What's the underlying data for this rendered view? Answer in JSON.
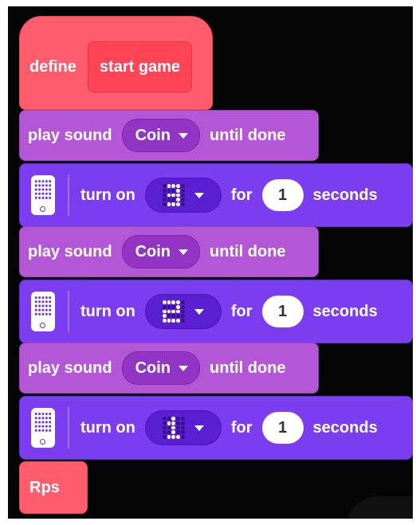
{
  "define_block": {
    "keyword": "define",
    "name": "start game"
  },
  "stack": [
    {
      "type": "sound",
      "prefix": "play sound",
      "sound": "Coin",
      "suffix": "until done"
    },
    {
      "type": "light",
      "prefix": "turn on",
      "pattern": [
        0,
        1,
        1,
        1,
        0,
        0,
        0,
        0,
        1,
        0,
        0,
        1,
        1,
        1,
        0,
        0,
        0,
        0,
        1,
        0,
        0,
        1,
        1,
        1,
        0
      ],
      "mid": "for",
      "value": "1",
      "unit": "seconds"
    },
    {
      "type": "sound",
      "prefix": "play sound",
      "sound": "Coin",
      "suffix": "until done"
    },
    {
      "type": "light",
      "prefix": "turn on",
      "pattern": [
        1,
        1,
        1,
        1,
        0,
        0,
        0,
        0,
        1,
        0,
        1,
        1,
        1,
        1,
        0,
        1,
        0,
        0,
        0,
        0,
        1,
        1,
        1,
        1,
        0
      ],
      "mid": "for",
      "value": "1",
      "unit": "seconds"
    },
    {
      "type": "sound",
      "prefix": "play sound",
      "sound": "Coin",
      "suffix": "until done"
    },
    {
      "type": "light",
      "prefix": "turn on",
      "pattern": [
        0,
        0,
        1,
        0,
        0,
        0,
        1,
        1,
        0,
        0,
        0,
        0,
        1,
        0,
        0,
        0,
        0,
        1,
        0,
        0,
        0,
        1,
        1,
        1,
        0
      ],
      "mid": "for",
      "value": "1",
      "unit": "seconds"
    }
  ],
  "final_block": {
    "label": "Rps"
  },
  "colors": {
    "event_red": "#ff5c6c",
    "sound_purple": "#b457d6",
    "light_violet": "#7c3df1",
    "canvas": "#050505"
  }
}
